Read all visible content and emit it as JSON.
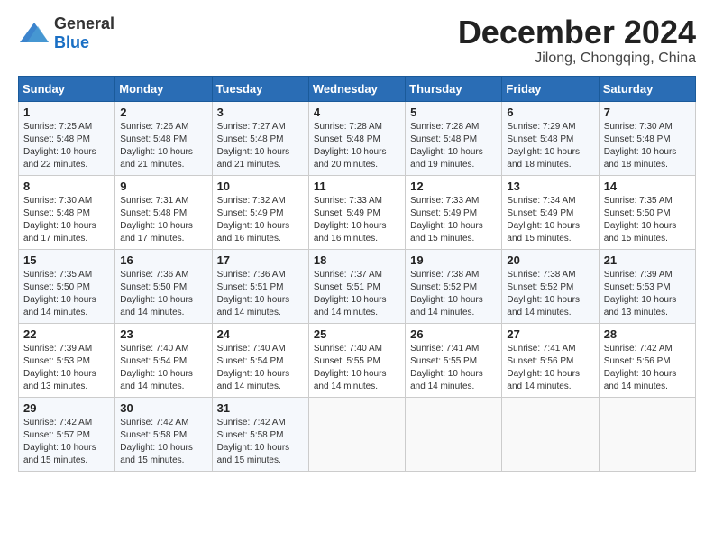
{
  "logo": {
    "general": "General",
    "blue": "Blue"
  },
  "header": {
    "month": "December 2024",
    "location": "Jilong, Chongqing, China"
  },
  "weekdays": [
    "Sunday",
    "Monday",
    "Tuesday",
    "Wednesday",
    "Thursday",
    "Friday",
    "Saturday"
  ],
  "weeks": [
    [
      {
        "day": "1",
        "sunrise": "7:25 AM",
        "sunset": "5:48 PM",
        "daylight": "10 hours and 22 minutes."
      },
      {
        "day": "2",
        "sunrise": "7:26 AM",
        "sunset": "5:48 PM",
        "daylight": "10 hours and 21 minutes."
      },
      {
        "day": "3",
        "sunrise": "7:27 AM",
        "sunset": "5:48 PM",
        "daylight": "10 hours and 21 minutes."
      },
      {
        "day": "4",
        "sunrise": "7:28 AM",
        "sunset": "5:48 PM",
        "daylight": "10 hours and 20 minutes."
      },
      {
        "day": "5",
        "sunrise": "7:28 AM",
        "sunset": "5:48 PM",
        "daylight": "10 hours and 19 minutes."
      },
      {
        "day": "6",
        "sunrise": "7:29 AM",
        "sunset": "5:48 PM",
        "daylight": "10 hours and 18 minutes."
      },
      {
        "day": "7",
        "sunrise": "7:30 AM",
        "sunset": "5:48 PM",
        "daylight": "10 hours and 18 minutes."
      }
    ],
    [
      {
        "day": "8",
        "sunrise": "7:30 AM",
        "sunset": "5:48 PM",
        "daylight": "10 hours and 17 minutes."
      },
      {
        "day": "9",
        "sunrise": "7:31 AM",
        "sunset": "5:48 PM",
        "daylight": "10 hours and 17 minutes."
      },
      {
        "day": "10",
        "sunrise": "7:32 AM",
        "sunset": "5:49 PM",
        "daylight": "10 hours and 16 minutes."
      },
      {
        "day": "11",
        "sunrise": "7:33 AM",
        "sunset": "5:49 PM",
        "daylight": "10 hours and 16 minutes."
      },
      {
        "day": "12",
        "sunrise": "7:33 AM",
        "sunset": "5:49 PM",
        "daylight": "10 hours and 15 minutes."
      },
      {
        "day": "13",
        "sunrise": "7:34 AM",
        "sunset": "5:49 PM",
        "daylight": "10 hours and 15 minutes."
      },
      {
        "day": "14",
        "sunrise": "7:35 AM",
        "sunset": "5:50 PM",
        "daylight": "10 hours and 15 minutes."
      }
    ],
    [
      {
        "day": "15",
        "sunrise": "7:35 AM",
        "sunset": "5:50 PM",
        "daylight": "10 hours and 14 minutes."
      },
      {
        "day": "16",
        "sunrise": "7:36 AM",
        "sunset": "5:50 PM",
        "daylight": "10 hours and 14 minutes."
      },
      {
        "day": "17",
        "sunrise": "7:36 AM",
        "sunset": "5:51 PM",
        "daylight": "10 hours and 14 minutes."
      },
      {
        "day": "18",
        "sunrise": "7:37 AM",
        "sunset": "5:51 PM",
        "daylight": "10 hours and 14 minutes."
      },
      {
        "day": "19",
        "sunrise": "7:38 AM",
        "sunset": "5:52 PM",
        "daylight": "10 hours and 14 minutes."
      },
      {
        "day": "20",
        "sunrise": "7:38 AM",
        "sunset": "5:52 PM",
        "daylight": "10 hours and 14 minutes."
      },
      {
        "day": "21",
        "sunrise": "7:39 AM",
        "sunset": "5:53 PM",
        "daylight": "10 hours and 13 minutes."
      }
    ],
    [
      {
        "day": "22",
        "sunrise": "7:39 AM",
        "sunset": "5:53 PM",
        "daylight": "10 hours and 13 minutes."
      },
      {
        "day": "23",
        "sunrise": "7:40 AM",
        "sunset": "5:54 PM",
        "daylight": "10 hours and 14 minutes."
      },
      {
        "day": "24",
        "sunrise": "7:40 AM",
        "sunset": "5:54 PM",
        "daylight": "10 hours and 14 minutes."
      },
      {
        "day": "25",
        "sunrise": "7:40 AM",
        "sunset": "5:55 PM",
        "daylight": "10 hours and 14 minutes."
      },
      {
        "day": "26",
        "sunrise": "7:41 AM",
        "sunset": "5:55 PM",
        "daylight": "10 hours and 14 minutes."
      },
      {
        "day": "27",
        "sunrise": "7:41 AM",
        "sunset": "5:56 PM",
        "daylight": "10 hours and 14 minutes."
      },
      {
        "day": "28",
        "sunrise": "7:42 AM",
        "sunset": "5:56 PM",
        "daylight": "10 hours and 14 minutes."
      }
    ],
    [
      {
        "day": "29",
        "sunrise": "7:42 AM",
        "sunset": "5:57 PM",
        "daylight": "10 hours and 15 minutes."
      },
      {
        "day": "30",
        "sunrise": "7:42 AM",
        "sunset": "5:58 PM",
        "daylight": "10 hours and 15 minutes."
      },
      {
        "day": "31",
        "sunrise": "7:42 AM",
        "sunset": "5:58 PM",
        "daylight": "10 hours and 15 minutes."
      },
      null,
      null,
      null,
      null
    ]
  ]
}
